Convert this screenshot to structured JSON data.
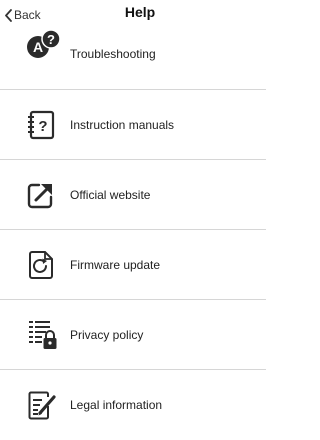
{
  "header": {
    "back_label": "Back",
    "title": "Help"
  },
  "items": [
    {
      "label": "Troubleshooting",
      "icon": "troubleshooting-icon"
    },
    {
      "label": "Instruction manuals",
      "icon": "manual-icon"
    },
    {
      "label": "Official website",
      "icon": "external-link-icon"
    },
    {
      "label": "Firmware update",
      "icon": "firmware-update-icon"
    },
    {
      "label": "Privacy policy",
      "icon": "privacy-lock-icon"
    },
    {
      "label": "Legal information",
      "icon": "legal-document-icon"
    }
  ],
  "colors": {
    "icon_dark": "#2b2b2b",
    "divider": "#d6d6d6",
    "text": "#222222"
  }
}
